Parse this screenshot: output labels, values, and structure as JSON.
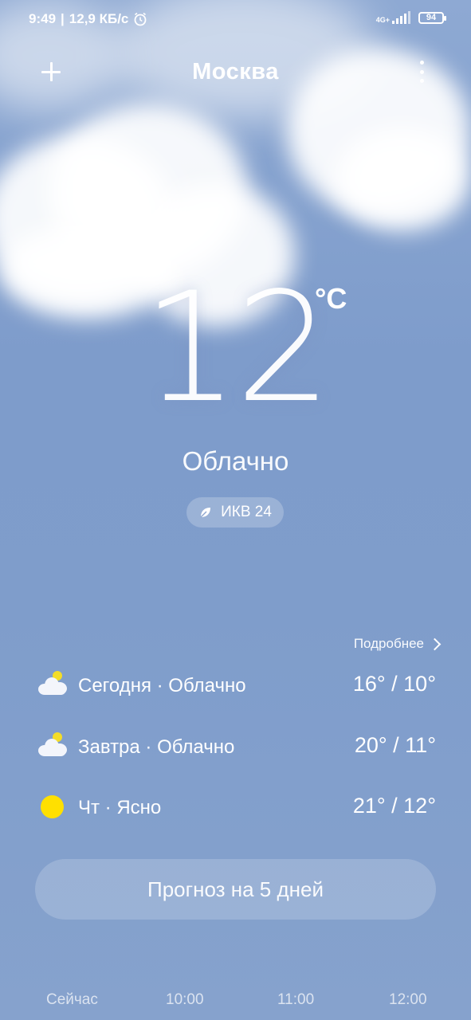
{
  "status_bar": {
    "time": "9:49",
    "separator": "|",
    "speed": "12,9 КБ/с",
    "network_type": "4G+",
    "battery": "94"
  },
  "header": {
    "city": "Москва",
    "add_icon": "plus-icon",
    "menu_icon": "more-vertical-icon"
  },
  "current": {
    "temperature": "12",
    "unit": "°C",
    "condition": "Облачно",
    "aqi_label": "ИКВ 24"
  },
  "details_link": "Подробнее",
  "forecast": [
    {
      "icon": "partly-cloudy-icon",
      "label": "Сегодня · Облачно",
      "temps": "16° / 10°"
    },
    {
      "icon": "partly-cloudy-icon",
      "label": "Завтра · Облачно",
      "temps": "20° / 11°"
    },
    {
      "icon": "sun-icon",
      "label": "Чт · Ясно",
      "temps": "21° / 12°"
    }
  ],
  "five_day_button": "Прогноз на 5 дней",
  "hourly": [
    "Сейчас",
    "10:00",
    "11:00",
    "12:00"
  ],
  "colors": {
    "sky": "#7f9dcb",
    "sun": "#ffe000"
  }
}
